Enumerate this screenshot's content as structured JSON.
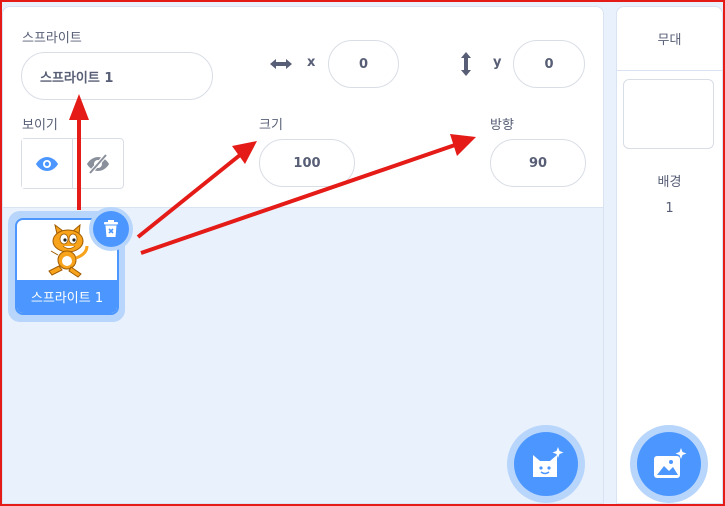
{
  "sprite_info": {
    "sprite_label": "스프라이트",
    "sprite_name_value": "스프라이트 1",
    "x_label": "x",
    "x_value": "0",
    "y_label": "y",
    "y_value": "0",
    "show_label": "보이기",
    "size_label": "크기",
    "size_value": "100",
    "direction_label": "방향",
    "direction_value": "90"
  },
  "sprites": [
    {
      "name": "스프라이트 1",
      "selected": true
    }
  ],
  "stage": {
    "header": "무대",
    "backdrop_label": "배경",
    "backdrop_count": "1"
  },
  "colors": {
    "accent": "#4c97ff",
    "annotation": "#e41b17"
  },
  "icons": {
    "x_axis": "horizontal-arrows-icon",
    "y_axis": "vertical-arrows-icon",
    "show": "eye-icon",
    "hide": "eye-slash-icon",
    "delete": "trash-icon",
    "add_sprite": "cat-plus-icon",
    "add_backdrop": "image-plus-icon"
  }
}
